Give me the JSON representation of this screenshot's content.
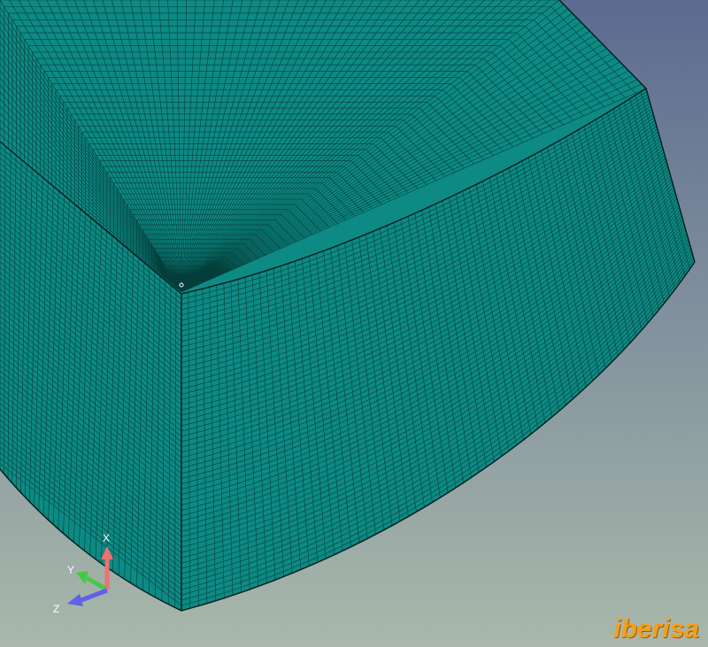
{
  "scene": {
    "background_top": "#5b6b90",
    "background_bottom": "#a9b8aa",
    "mesh_fill": "#0d8a84",
    "mesh_line": "#04302e",
    "mesh_edge": "#021c1b"
  },
  "triad": {
    "x_label": "X",
    "y_label": "Y",
    "z_label": "Z",
    "x_color": "#f07070",
    "y_color": "#48c848",
    "z_color": "#6060e8"
  },
  "brand": {
    "logo_text": "iberisa",
    "color": "#f0a020"
  }
}
